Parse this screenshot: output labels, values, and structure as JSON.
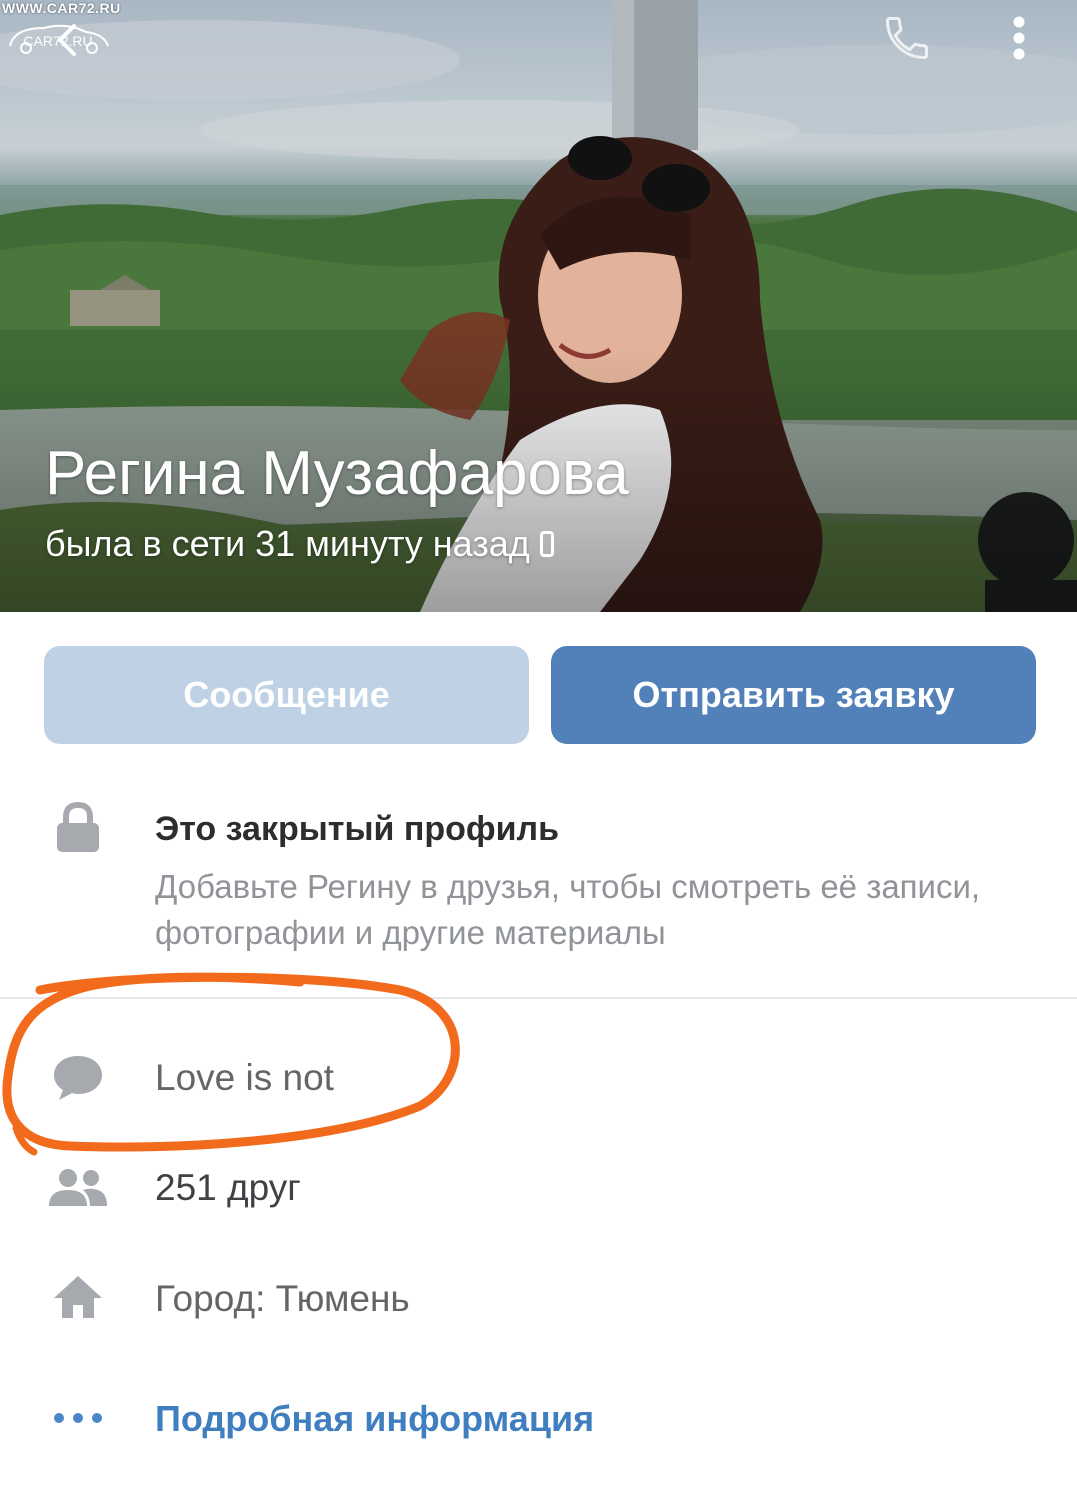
{
  "watermark": {
    "url": "WWW.CAR72.RU",
    "logo_text": "CAR72.RU"
  },
  "header": {
    "back_icon": "back-arrow-icon",
    "call_icon": "phone-icon",
    "more_icon": "more-vertical-icon"
  },
  "profile": {
    "name": "Регина Музафарова",
    "status": "была в сети 31 минуту назад",
    "status_device_icon": "mobile-phone-icon"
  },
  "actions": {
    "message_label": "Сообщение",
    "request_label": "Отправить заявку"
  },
  "closed_profile": {
    "icon": "lock-icon",
    "title": "Это закрытый профиль",
    "description": "Добавьте Регину в друзья, чтобы смотреть её записи, фотографии и другие материалы"
  },
  "info": {
    "status_icon": "speech-bubble-icon",
    "status_text": "Love is not",
    "friends_icon": "friends-icon",
    "friends_text": "251 друг",
    "city_icon": "home-icon",
    "city_text": "Город: Тюмень",
    "details_icon": "more-horizontal-icon",
    "details_link": "Подробная информация"
  },
  "colors": {
    "primary_button": "#5181b8",
    "disabled_button": "#bfd1e5",
    "link": "#3f7fc0",
    "highlight": "#f26b1d"
  }
}
